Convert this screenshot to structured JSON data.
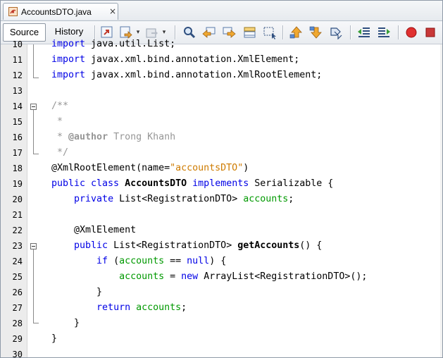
{
  "tab": {
    "file_name": "AccountsDTO.java",
    "close": "×"
  },
  "toolbar": {
    "source_label": "Source",
    "history_label": "History",
    "icons": [
      "last-edit-icon",
      "back-icon",
      "dropdown-arrow-icon",
      "forward-icon",
      "dropdown-arrow-icon",
      "find-icon",
      "find-previous-icon",
      "find-next-icon",
      "toggle-highlight-icon",
      "select-icon",
      "previous-bookmark-icon",
      "next-bookmark-icon",
      "toggle-bookmark-icon",
      "shift-left-icon",
      "shift-right-icon",
      "record-macro-icon",
      "stop-macro-icon"
    ]
  },
  "editor": {
    "lines": [
      {
        "num": "10",
        "tokens": [
          {
            "t": "import",
            "c": "kw"
          },
          {
            "t": " java.util.List;",
            "c": ""
          }
        ]
      },
      {
        "num": "11",
        "tokens": [
          {
            "t": "import",
            "c": "kw"
          },
          {
            "t": " javax.xml.bind.annotation.XmlElement;",
            "c": ""
          }
        ]
      },
      {
        "num": "12",
        "tokens": [
          {
            "t": "import",
            "c": "kw"
          },
          {
            "t": " javax.xml.bind.annotation.XmlRootElement;",
            "c": ""
          }
        ]
      },
      {
        "num": "13",
        "tokens": []
      },
      {
        "num": "14",
        "tokens": [
          {
            "t": "/**",
            "c": "cm"
          }
        ]
      },
      {
        "num": "15",
        "tokens": [
          {
            "t": " *",
            "c": "cm"
          }
        ]
      },
      {
        "num": "16",
        "tokens": [
          {
            "t": " * ",
            "c": "cm"
          },
          {
            "t": "@author",
            "c": "cmb"
          },
          {
            "t": " Trong Khanh",
            "c": "cm"
          }
        ]
      },
      {
        "num": "17",
        "tokens": [
          {
            "t": " */",
            "c": "cm"
          }
        ]
      },
      {
        "num": "18",
        "tokens": [
          {
            "t": "@XmlRootElement(name=",
            "c": "ann"
          },
          {
            "t": "\"accountsDTO\"",
            "c": "str"
          },
          {
            "t": ")",
            "c": ""
          }
        ]
      },
      {
        "num": "19",
        "tokens": [
          {
            "t": "public class",
            "c": "kw"
          },
          {
            "t": " ",
            "c": ""
          },
          {
            "t": "AccountsDTO",
            "c": "bold"
          },
          {
            "t": " ",
            "c": ""
          },
          {
            "t": "implements",
            "c": "kw"
          },
          {
            "t": " Serializable {",
            "c": ""
          }
        ]
      },
      {
        "num": "20",
        "tokens": [
          {
            "t": "    ",
            "c": ""
          },
          {
            "t": "private",
            "c": "kw"
          },
          {
            "t": " List<RegistrationDTO> ",
            "c": ""
          },
          {
            "t": "accounts",
            "c": "fld"
          },
          {
            "t": ";",
            "c": ""
          }
        ]
      },
      {
        "num": "21",
        "tokens": []
      },
      {
        "num": "22",
        "tokens": [
          {
            "t": "    @XmlElement",
            "c": "ann"
          }
        ]
      },
      {
        "num": "23",
        "tokens": [
          {
            "t": "    ",
            "c": ""
          },
          {
            "t": "public",
            "c": "kw"
          },
          {
            "t": " List<RegistrationDTO> ",
            "c": ""
          },
          {
            "t": "getAccounts",
            "c": "bold"
          },
          {
            "t": "() {",
            "c": ""
          }
        ]
      },
      {
        "num": "24",
        "tokens": [
          {
            "t": "        ",
            "c": ""
          },
          {
            "t": "if",
            "c": "kw"
          },
          {
            "t": " (",
            "c": ""
          },
          {
            "t": "accounts",
            "c": "fld"
          },
          {
            "t": " == ",
            "c": ""
          },
          {
            "t": "null",
            "c": "kw"
          },
          {
            "t": ") {",
            "c": ""
          }
        ]
      },
      {
        "num": "25",
        "tokens": [
          {
            "t": "            ",
            "c": ""
          },
          {
            "t": "accounts",
            "c": "fld"
          },
          {
            "t": " = ",
            "c": ""
          },
          {
            "t": "new",
            "c": "kw"
          },
          {
            "t": " ArrayList<RegistrationDTO>();",
            "c": ""
          }
        ]
      },
      {
        "num": "26",
        "tokens": [
          {
            "t": "        }",
            "c": ""
          }
        ]
      },
      {
        "num": "27",
        "tokens": [
          {
            "t": "        ",
            "c": ""
          },
          {
            "t": "return",
            "c": "kw"
          },
          {
            "t": " ",
            "c": ""
          },
          {
            "t": "accounts",
            "c": "fld"
          },
          {
            "t": ";",
            "c": ""
          }
        ]
      },
      {
        "num": "28",
        "tokens": [
          {
            "t": "    }",
            "c": ""
          }
        ]
      },
      {
        "num": "29",
        "tokens": [
          {
            "t": "}",
            "c": ""
          }
        ]
      },
      {
        "num": "30",
        "tokens": []
      }
    ]
  },
  "colors": {
    "keyword": "#0000e6",
    "comment": "#969696",
    "field": "#009900",
    "string": "#ce7b00"
  }
}
